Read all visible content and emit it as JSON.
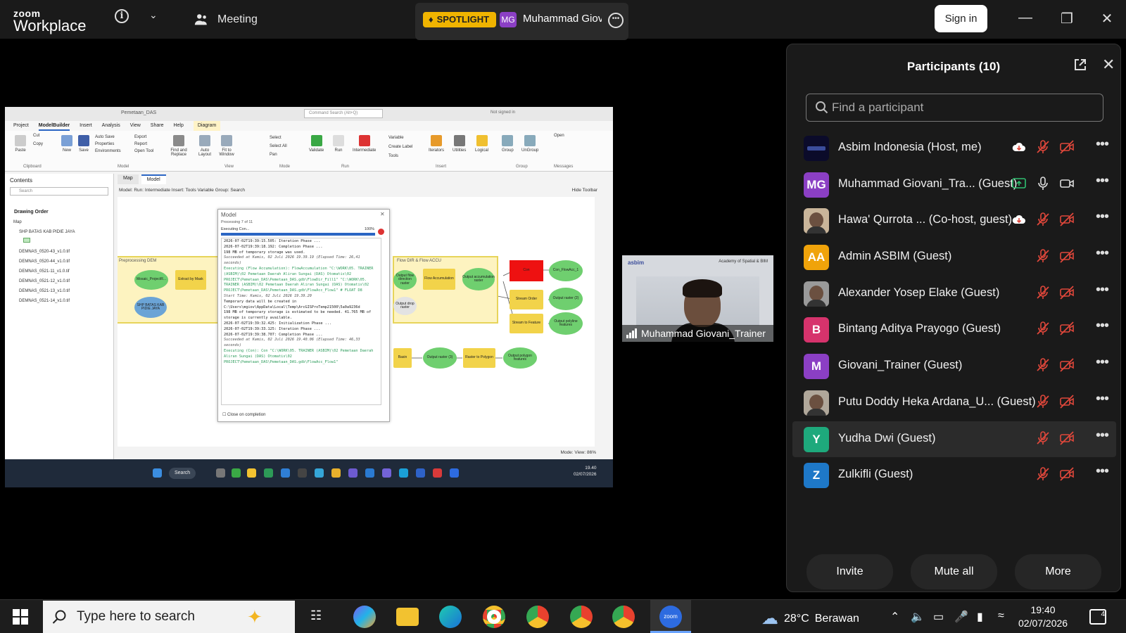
{
  "topbar": {
    "logo_line1": "zoom",
    "logo_line2": "Workplace",
    "meeting_label": "Meeting",
    "spotlight_label": "SPOTLIGHT",
    "spotlight_initials": "MG",
    "spotlight_name": "Muhammad Giovani_Trainer",
    "sign_in": "Sign in"
  },
  "shared_screen": {
    "window_title": "Pemetaan_DAS",
    "command_search": "Command Search (Alt+Q)",
    "not_signed_in": "Not signed in",
    "menu": [
      "Project",
      "ModelBuilder",
      "Insert",
      "Analysis",
      "View",
      "Share",
      "Help",
      "Diagram"
    ],
    "ribbon": {
      "paste": "Paste",
      "cut": "Cut",
      "copy": "Copy",
      "new": "New",
      "save": "Save",
      "auto_save": "Auto Save",
      "properties": "Properties",
      "environments": "Environments",
      "export": "Export",
      "report": "Report",
      "open_tool": "Open Tool",
      "find_replace": "Find and Replace",
      "auto_layout": "Auto Layout",
      "fit_window": "Fit to Window",
      "select": "Select",
      "select_all": "Select All",
      "pan": "Pan",
      "validate": "Validate",
      "run": "Run",
      "intermediate": "Intermediate",
      "variable": "Variable",
      "create_label": "Create Label",
      "tools": "Tools",
      "iterators": "Iterators",
      "utilities": "Utilities",
      "logical": "Logical",
      "group": "Group",
      "ungroup": "UnGroup",
      "open": "Open",
      "groups": [
        "Clipboard",
        "Model",
        "View",
        "Mode",
        "Run",
        "Insert",
        "Group",
        "Messages"
      ]
    },
    "contents": {
      "title": "Contents",
      "search_placeholder": "Search",
      "drawing_order": "Drawing Order",
      "layers": [
        "Map",
        "SHP BATAS KAB PIDIE JAYA",
        "DEMNAS_0520-43_v1.0.tif",
        "DEMNAS_0520-44_v1.0.tif",
        "DEMNAS_0521-11_v1.0.tif",
        "DEMNAS_0521-12_v1.0.tif",
        "DEMNAS_0521-13_v1.0.tif",
        "DEMNAS_0521-14_v1.0.tif"
      ]
    },
    "tabs": [
      "Map",
      "Model"
    ],
    "model_toolbar": "Model:  Run:  Intermediate  Insert:  Tools  Variable  Group:  Search",
    "hide_toolbar": "Hide Toolbar",
    "diagram": {
      "band1_label": "Preprocessing DEM",
      "band2_label": "Flow DIR & Flow ACCU",
      "nodes": {
        "mosaic": "Mosaic_ProjectR...",
        "extract": "Extract by Mask",
        "shp": "SHP BATAS KAB PIDIE JAYA",
        "flowdir_out": "Output flow direction raster",
        "flow_acc": "Flow Accumulation",
        "out_acc": "Output accumulation raster",
        "con": "Con",
        "con_out": "Con_FlowAcc_1",
        "stream_order": "Stream Order",
        "out_raster2": "Output raster (2)",
        "stream_feature": "Stream to Feature",
        "out_polyline": "Output polyline features",
        "drop": "Output drop raster",
        "basin": "Basin",
        "out_raster3": "Output raster (3)",
        "r2p": "Raster to Polygon",
        "out_poly": "Output polygon features"
      }
    },
    "dialog": {
      "title": "Model",
      "processing": "Processing 7 of 11",
      "executing": "Executing Con...",
      "percent": "100%",
      "progress": 1.0,
      "close_on_completion": "Close on completion",
      "log": [
        {
          "t": "2026-07-02T19:39:15.505: Iteration Phase ...",
          "c": ""
        },
        {
          "t": "2026-07-02T19:39:18.192: Completion Phase ...",
          "c": ""
        },
        {
          "t": "198 MB of temporary storage was used.",
          "c": ""
        },
        {
          "t": "Succeeded at Kamis, 02 Juli 2026 19.39.19 (Elapsed Time: 26,41 seconds)",
          "c": "i"
        },
        {
          "t": "Executing (Flow Accumulation): FlowAccumulation \"C:\\WORK\\05. TRAINER (ASBIM)\\02 Pemetaan Daerah Aliran Sungai (DAS) Otomatis\\02 PROJECT\\Pemetaan_DAS\\Pemetaan_DAS.gdb\\FlowDir_Fill1\" \"C:\\WORK\\05. TRAINER (ASBIM)\\02 Pemetaan Daerah Aliran Sungai (DAS) Otomatis\\02 PROJECT\\Pemetaan_DAS\\Pemetaan_DAS.gdb\\FlowAcc_Flow1\" # FLOAT D8",
          "c": "g"
        },
        {
          "t": "Start Time: Kamis, 02 Juli 2026 19.39.20",
          "c": "i"
        },
        {
          "t": "Temporary data will be created in C:\\Users\\mgiov\\AppData\\Local\\Temp\\ArcGISProTemp21500\\5a0a9236d",
          "c": ""
        },
        {
          "t": "198 MB of temporary storage is estimated to be needed. 41.765 MB of storage is currently available.",
          "c": ""
        },
        {
          "t": "2026-07-02T19:39:32.425: Initialization Phase ...",
          "c": ""
        },
        {
          "t": "2026-07-02T19:39:33.125: Iteration Phase ...",
          "c": ""
        },
        {
          "t": "2026-07-02T19:39:38.707: Completion Phase ...",
          "c": ""
        },
        {
          "t": "Succeeded at Kamis, 02 Juli 2026 19.40.06 (Elapsed Time: 46,33 seconds)",
          "c": "i"
        },
        {
          "t": "Executing (Con): Con \"C:\\WORK\\05. TRAINER (ASBIM)\\02 Pemetaan Daerah Aliran Sungai (DAS) Otomatis\\02 PROJECT\\Pemetaan_DAS\\Pemetaan_DAS.gdb\\FlowAcc_Flow1\"",
          "c": "g"
        }
      ]
    },
    "status": "Mode:  View:  86%",
    "inner_taskbar_search": "Search",
    "inner_clock_time": "19.40",
    "inner_clock_date": "02/07/2026"
  },
  "webcam": {
    "brand": "asbim",
    "academy": "Academy of Spatial & BIM",
    "name": "Muhammad Giovani_Trainer"
  },
  "participants": {
    "title": "Participants (10)",
    "search_placeholder": "Find a participant",
    "list": [
      {
        "name": "Asbim Indonesia (Host, me)",
        "initials": "",
        "color": "#111111",
        "pic": "logo"
      },
      {
        "name": "Muhammad Giovani_Tra...  (Guest)",
        "initials": "MG",
        "color": "#8b3fc4",
        "pic": ""
      },
      {
        "name": "Hawa' Qurrota ...  (Co-host, guest)",
        "initials": "",
        "color": "#c9b59a",
        "pic": "photo"
      },
      {
        "name": "Admin ASBIM (Guest)",
        "initials": "AA",
        "color": "#f0a30a",
        "pic": ""
      },
      {
        "name": "Alexander Yosep Elake (Guest)",
        "initials": "",
        "color": "#9a9a9a",
        "pic": "photo"
      },
      {
        "name": "Bintang Aditya Prayogo (Guest)",
        "initials": "B",
        "color": "#d6336c",
        "pic": ""
      },
      {
        "name": "Giovani_Trainer (Guest)",
        "initials": "M",
        "color": "#8b3fc4",
        "pic": ""
      },
      {
        "name": "Putu Doddy Heka Ardana_U...  (Guest)",
        "initials": "",
        "color": "#b0a79a",
        "pic": "photo"
      },
      {
        "name": "Yudha Dwi (Guest)",
        "initials": "Y",
        "color": "#1ea97c",
        "pic": ""
      },
      {
        "name": "Zulkifli (Guest)",
        "initials": "Z",
        "color": "#1e78c8",
        "pic": ""
      }
    ],
    "invite": "Invite",
    "mute_all": "Mute all",
    "more": "More"
  },
  "taskbar": {
    "search_placeholder": "Type here to search",
    "temperature": "28°C",
    "weather": "Berawan",
    "time": "19:40",
    "date": "02/07/2026",
    "notifications": "4"
  },
  "colors": {
    "accent_blue": "#2b66c4",
    "muted_red": "#e0473b",
    "spotlight_yellow": "#f0b400",
    "share_green": "#2fbf71"
  }
}
